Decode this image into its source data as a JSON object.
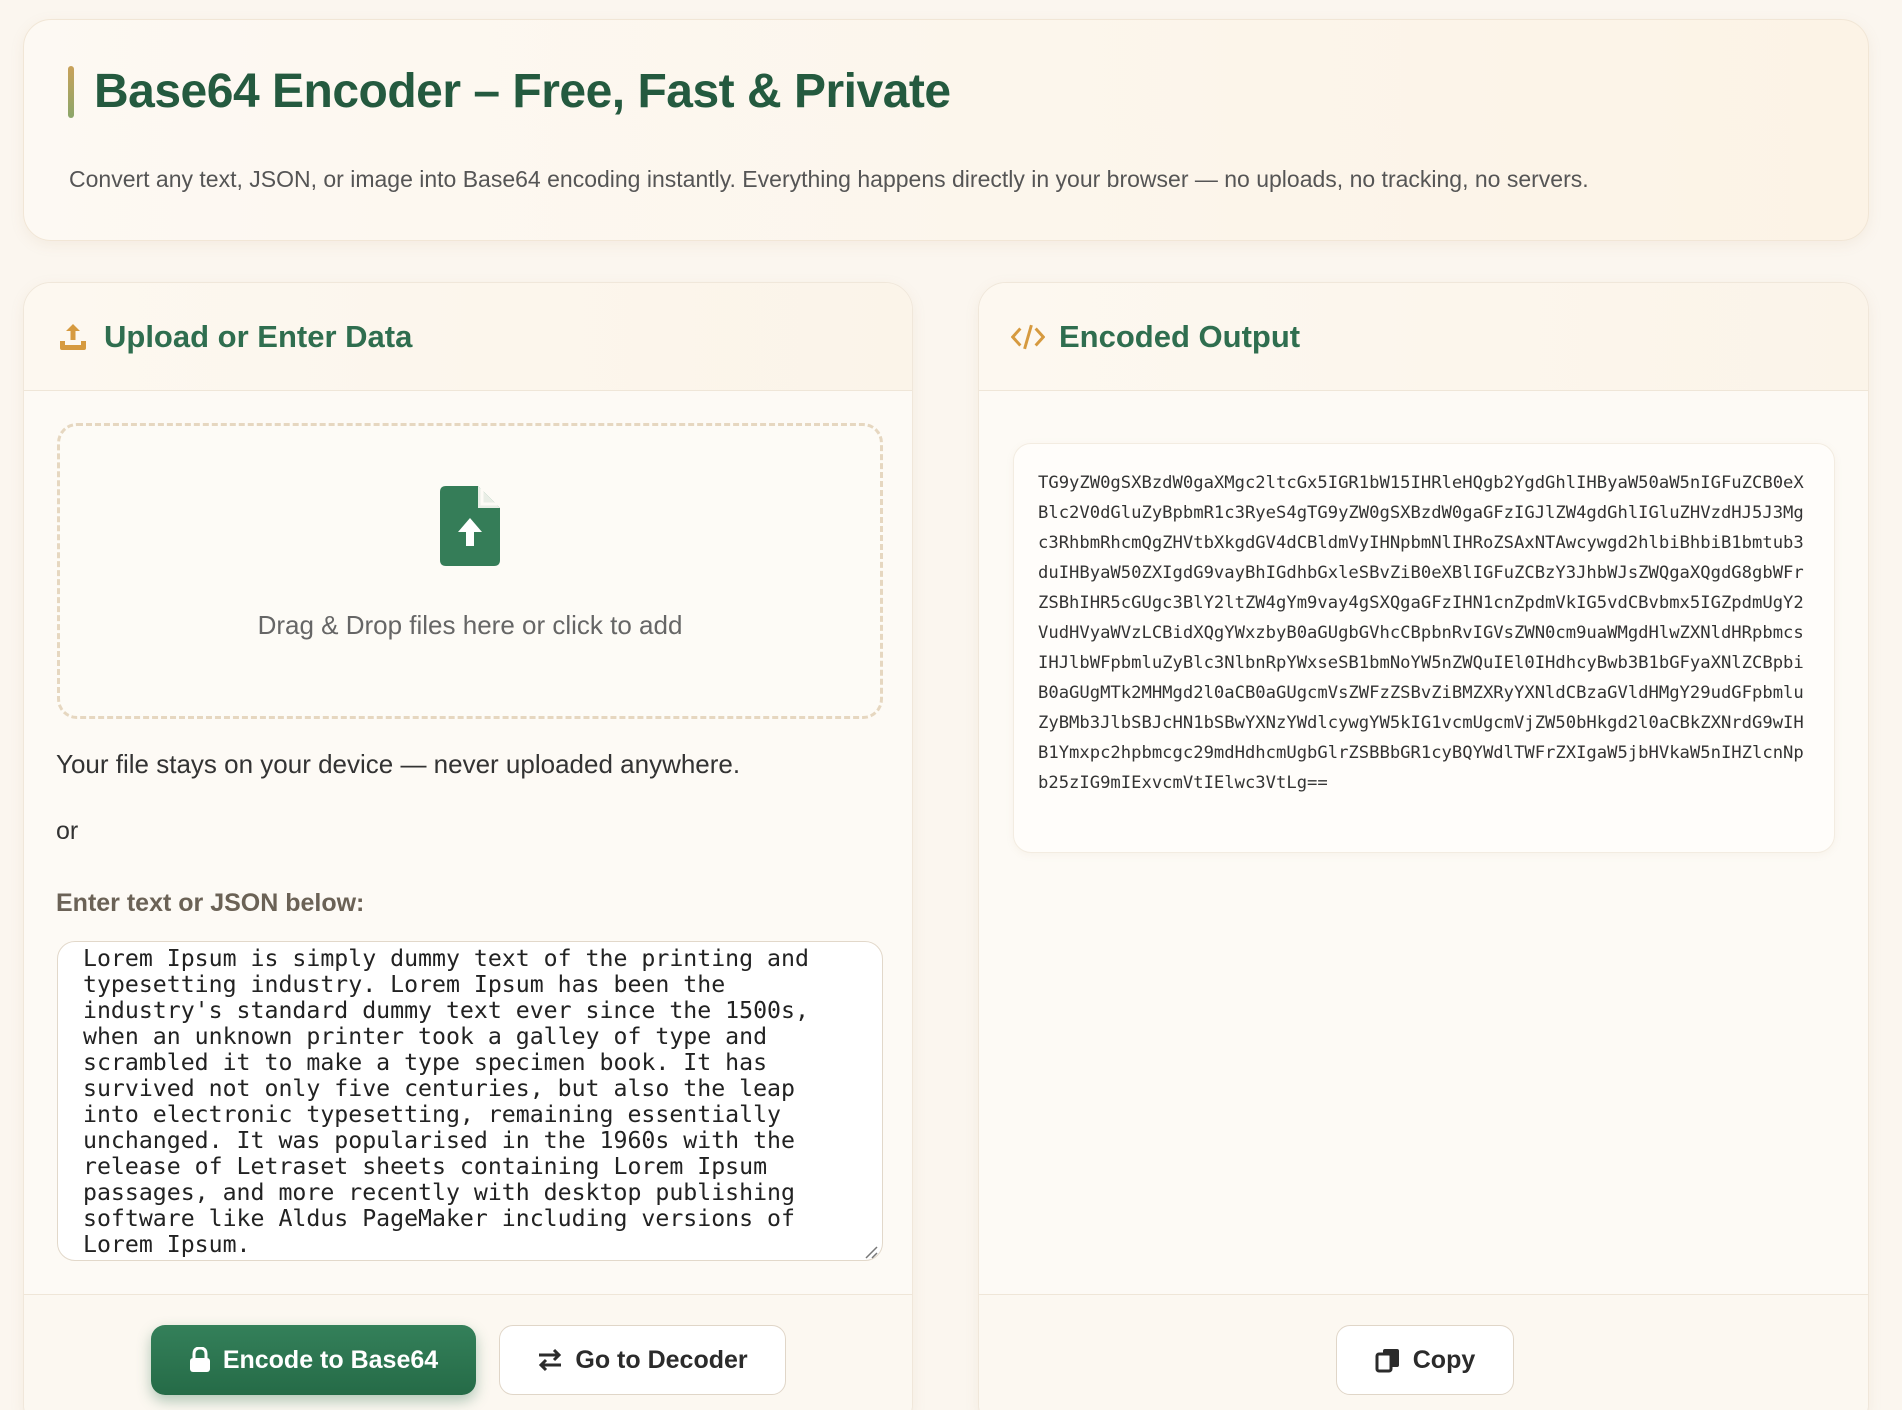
{
  "header": {
    "title": "Base64 Encoder – Free, Fast & Private",
    "subtitle": "Convert any text, JSON, or image into Base64 encoding instantly. Everything happens directly in your browser — no uploads, no tracking, no servers."
  },
  "input_panel": {
    "title": "Upload or Enter Data",
    "icon": "upload-icon",
    "dropzone_text": "Drag & Drop files here or click to add",
    "dropzone_icon": "file-upload-icon",
    "privacy_note": "Your file stays on your device — never uploaded anywhere.",
    "or_text": "or",
    "textarea_label": "Enter text or JSON below:",
    "textarea_value": "Lorem Ipsum is simply dummy text of the printing and typesetting industry. Lorem Ipsum has been the industry's standard dummy text ever since the 1500s, when an unknown printer took a galley of type and scrambled it to make a type specimen book. It has survived not only five centuries, but also the leap into electronic typesetting, remaining essentially unchanged. It was popularised in the 1960s with the release of Letraset sheets containing Lorem Ipsum passages, and more recently with desktop publishing software like Aldus PageMaker including versions of Lorem Ipsum.",
    "encode_button": "Encode to Base64",
    "encode_icon": "lock-icon",
    "decoder_button": "Go to Decoder",
    "decoder_icon": "swap-arrows-icon"
  },
  "output_panel": {
    "title": "Encoded Output",
    "icon": "code-icon",
    "output_text": "TG9yZW0gSXBzdW0gaXMgc2ltcGx5IGR1bW15IHRleHQgb2YgdGhlIHByaW50aW5nIGFuZCB0eXBlc2V0dGluZyBpbmR1c3RyeS4gTG9yZW0gSXBzdW0gaGFzIGJlZW4gdGhlIGluZHVzdHJ5J3Mgc3RhbmRhcmQgZHVtbXkgdGV4dCBldmVyIHNpbmNlIHRoZSAxNTAwcywgd2hlbiBhbiB1bmtub3duIHByaW50ZXIgdG9vayBhIGdhbGxleSBvZiB0eXBlIGFuZCBzY3JhbWJsZWQgaXQgdG8gbWFrZSBhIHR5cGUgc3BlY2ltZW4gYm9vay4gSXQgaGFzIHN1cnZpdmVkIG5vdCBvbmx5IGZpdmUgY2VudHVyaWVzLCBidXQgYWxzbyB0aGUgbGVhcCBpbnRvIGVsZWN0cm9uaWMgdHlwZXNldHRpbmcsIHJlbWFpbmluZyBlc3NlbnRpYWxseSB1bmNoYW5nZWQuIEl0IHdhcyBwb3B1bGFyaXNlZCBpbiB0aGUgMTk2MHMgd2l0aCB0aGUgcmVsZWFzZSBvZiBMZXRyYXNldCBzaGVldHMgY29udGFpbmluZyBMb3JlbSBJcHN1bSBwYXNzYWdlcywgYW5kIG1vcmUgcmVjZW50bHkgd2l0aCBkZXNrdG9wIHB1Ymxpc2hpbmcgc29mdHdhcmUgbGlrZSBBbGR1cyBQYWdlTWFrZXIgaW5jbHVkaW5nIHZlcnNpb25zIG9mIExvcmVtIElwc3VtLg==",
    "copy_button": "Copy",
    "copy_icon": "copy-icon"
  },
  "colors": {
    "brand_green": "#245a3f",
    "accent_gold": "#c9a25a",
    "background": "#fbf6ef"
  }
}
